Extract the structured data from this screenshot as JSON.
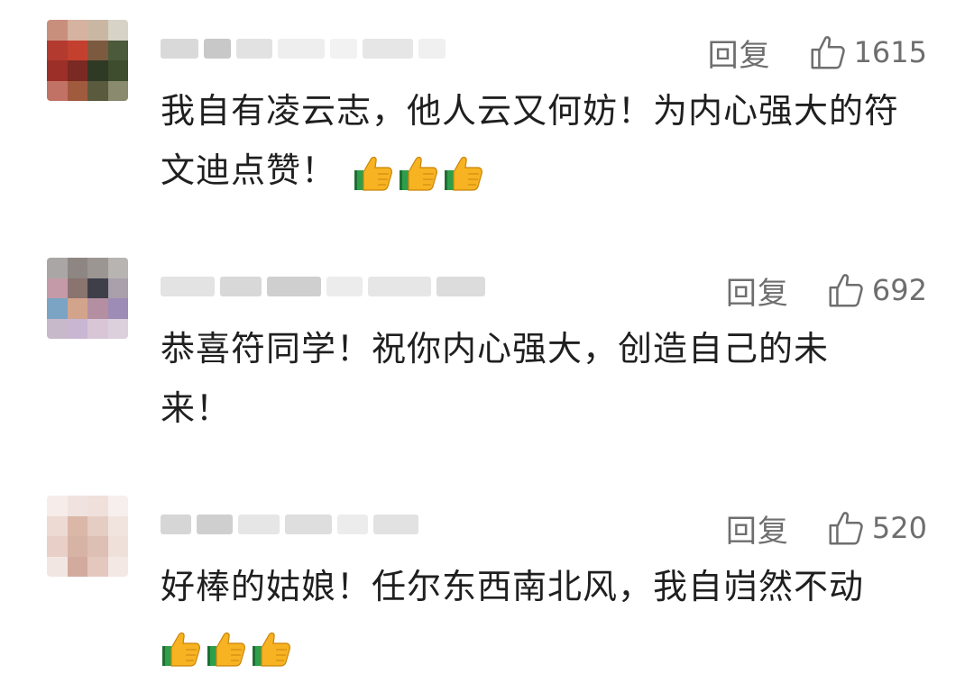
{
  "comments": [
    {
      "reply_label": "回复",
      "like_count": "1615",
      "text": "我自有凌云志，他人云又何妨！为内心强大的符文迪点赞！",
      "emoji_name": "thumbs-up-emoji",
      "emoji_count": 3
    },
    {
      "reply_label": "回复",
      "like_count": "692",
      "text": "恭喜符同学！祝你内心强大，创造自己的未来！",
      "emoji_count": 0
    },
    {
      "reply_label": "回复",
      "like_count": "520",
      "text": "好棒的姑娘！任尔东西南北风，我自岿然不动",
      "emoji_name": "thumbs-up-emoji",
      "emoji_count": 3
    }
  ],
  "colors": {
    "text": "#1f1f1f",
    "meta": "#6e6e6e",
    "background": "#ffffff"
  }
}
